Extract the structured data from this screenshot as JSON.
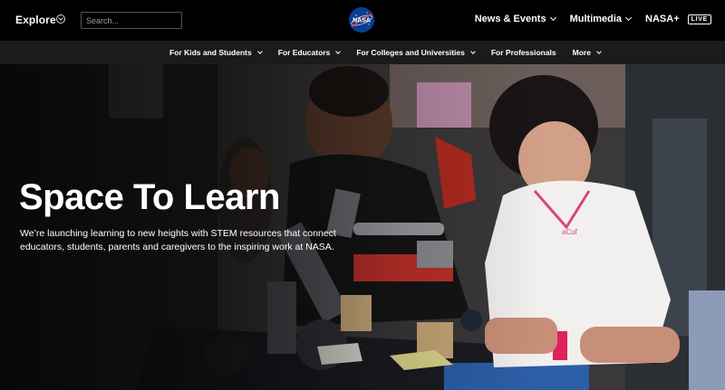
{
  "header": {
    "explore_label": "Explore",
    "search_placeholder": "Search...",
    "logo_icon": "nasa-meatball-logo",
    "nav": [
      {
        "label": "News & Events"
      },
      {
        "label": "Multimedia"
      },
      {
        "label": "NASA+",
        "badge": "LIVE"
      }
    ]
  },
  "subnav": {
    "items": [
      {
        "label": "For Kids and Students"
      },
      {
        "label": "For Educators"
      },
      {
        "label": "For Colleges and Universities"
      },
      {
        "label": "For Professionals"
      },
      {
        "label": "More"
      }
    ]
  },
  "hero": {
    "title": "Space To Learn",
    "description": "We’re launching learning to new heights with STEM resources that connect educators, students, parents and caregivers to the inspiring work at NASA.",
    "image_shirt_text": "aCuf"
  },
  "colors": {
    "logo_blue": "#0b3d91",
    "logo_red": "#fc3d21",
    "topbar": "#000000",
    "subnav": "#1b1b1b"
  }
}
